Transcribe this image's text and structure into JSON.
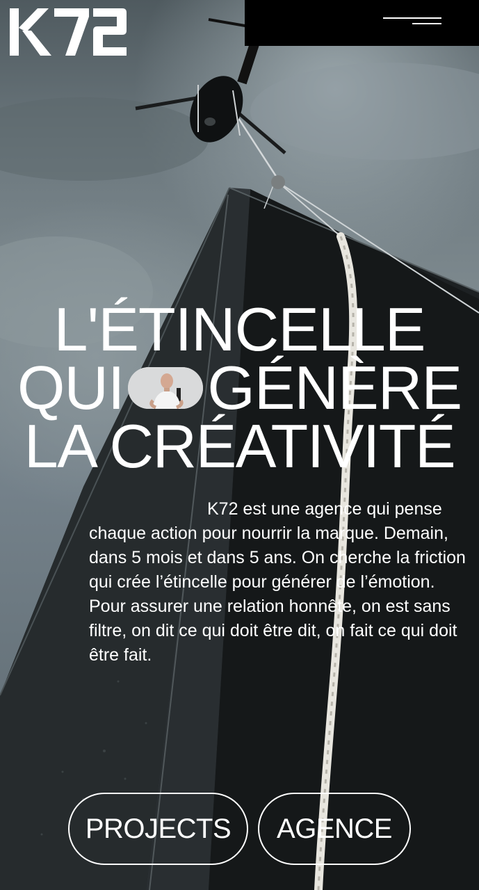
{
  "brand": {
    "logo_text": "K72"
  },
  "header": {
    "menu_icon": "hamburger-menu-icon"
  },
  "hero": {
    "headline_line1": "L'ÉTINCELLE",
    "headline_line2_before": "QUI",
    "headline_line2_after": "GÉNÈRE",
    "headline_line3": "LA CRÉATIVITÉ",
    "intro": "K72 est une agence qui pense chaque action pour nourrir la marque. Demain, dans 5 mois et dans 5 ans. On cherche la friction qui crée l’étincelle pour générer de l’émotion. Pour assurer une relation honnête, on est sans filtre, on dit ce qui doit être dit, on fait ce qui doit être fait."
  },
  "actions": {
    "projects_label": "PROJECTS",
    "agence_label": "AGENCE"
  },
  "colors": {
    "text": "#ffffff",
    "menu_bar": "#000000",
    "pill_bg": "#d9dadb"
  }
}
